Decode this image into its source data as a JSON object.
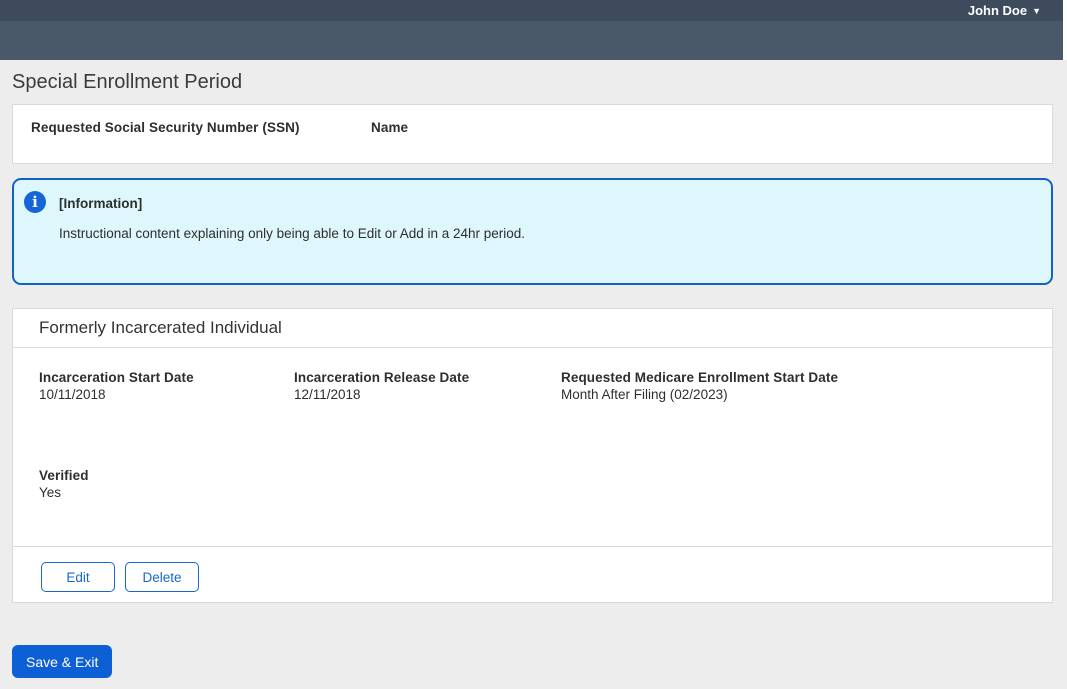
{
  "header": {
    "user_name": "John Doe",
    "caret_icon": "▼"
  },
  "page": {
    "title": "Special Enrollment Period"
  },
  "summary_card": {
    "fields": [
      {
        "label": "Requested Social Security Number (SSN)",
        "value": ""
      },
      {
        "label": "Name",
        "value": ""
      }
    ]
  },
  "info_box": {
    "icon_glyph": "i",
    "title": "[Information]",
    "body": "Instructional content explaining only being able to Edit or Add in a 24hr period."
  },
  "incarceration_card": {
    "title": "Formerly Incarcerated Individual",
    "fields": [
      {
        "label": "Incarceration Start Date",
        "value": "10/11/2018"
      },
      {
        "label": "Incarceration Release Date",
        "value": "12/11/2018"
      },
      {
        "label": "Requested Medicare Enrollment Start Date",
        "value": "Month After Filing (02/2023)"
      },
      {
        "label": "Verified",
        "value": "Yes"
      }
    ],
    "actions": [
      {
        "label": "Edit"
      },
      {
        "label": "Delete"
      }
    ]
  },
  "footer": {
    "save_exit_label": "Save & Exit"
  },
  "colors": {
    "topbar": "#3d4b5c",
    "subbar": "#4a5969",
    "page_background": "#ededee",
    "card_border": "#d9d9d9",
    "info_background": "#ddf7fd",
    "info_border": "#1461c4",
    "accent_blue": "#1766d1",
    "primary_button": "#0c5fd4"
  }
}
